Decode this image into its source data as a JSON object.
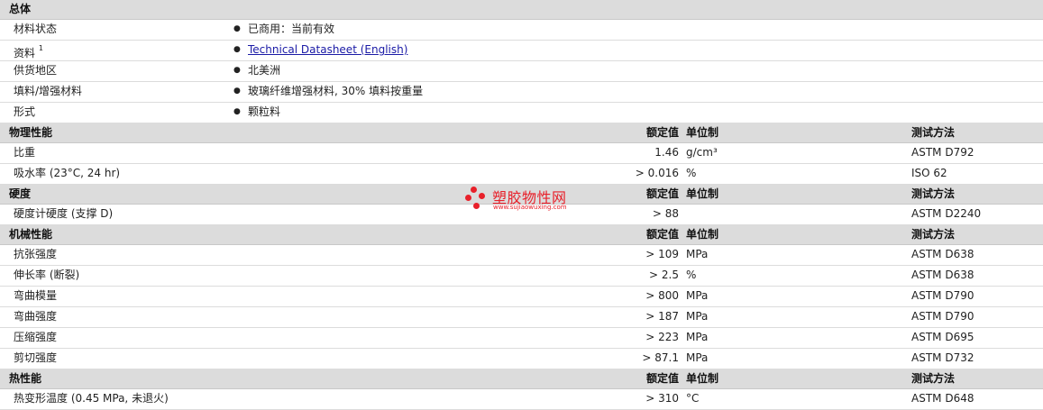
{
  "sections": {
    "general": {
      "title": "总体",
      "rows": [
        {
          "label": "材料状态",
          "sup": "",
          "value": "已商用：当前有效",
          "link": false
        },
        {
          "label": "资料",
          "sup": "1",
          "value": "Technical Datasheet (English)",
          "link": true
        },
        {
          "label": "供货地区",
          "sup": "",
          "value": "北美洲",
          "link": false
        },
        {
          "label": "填料/增强材料",
          "sup": "",
          "value": "玻璃纤维增强材料, 30% 填料按重量",
          "link": false
        },
        {
          "label": "形式",
          "sup": "",
          "value": "颗粒料",
          "link": false
        }
      ]
    },
    "physical": {
      "title": "物理性能",
      "col_value": "额定值",
      "col_unit": "单位制",
      "col_test": "测试方法",
      "rows": [
        {
          "label": "比重",
          "value": "1.46",
          "unit": "g/cm³",
          "test": "ASTM D792"
        },
        {
          "label": "吸水率 (23°C, 24 hr)",
          "value": "> 0.016",
          "unit": "%",
          "test": "ISO 62"
        }
      ]
    },
    "hardness": {
      "title": "硬度",
      "col_value": "额定值",
      "col_unit": "单位制",
      "col_test": "测试方法",
      "rows": [
        {
          "label": "硬度计硬度 (支撑 D)",
          "value": "> 88",
          "unit": "",
          "test": "ASTM D2240"
        }
      ]
    },
    "mechanical": {
      "title": "机械性能",
      "col_value": "额定值",
      "col_unit": "单位制",
      "col_test": "测试方法",
      "rows": [
        {
          "label": "抗张强度",
          "value": "> 109",
          "unit": "MPa",
          "test": "ASTM D638"
        },
        {
          "label": "伸长率 (断裂)",
          "value": "> 2.5",
          "unit": "%",
          "test": "ASTM D638"
        },
        {
          "label": "弯曲模量",
          "value": "> 800",
          "unit": "MPa",
          "test": "ASTM D790"
        },
        {
          "label": "弯曲强度",
          "value": "> 187",
          "unit": "MPa",
          "test": "ASTM D790"
        },
        {
          "label": "压缩强度",
          "value": "> 223",
          "unit": "MPa",
          "test": "ASTM D695"
        },
        {
          "label": "剪切强度",
          "value": "> 87.1",
          "unit": "MPa",
          "test": "ASTM D732"
        }
      ]
    },
    "thermal": {
      "title": "热性能",
      "col_value": "额定值",
      "col_unit": "单位制",
      "col_test": "测试方法",
      "rows": [
        {
          "label": "热变形温度 (0.45 MPa, 未退火)",
          "value": "> 310",
          "unit": "°C",
          "test": "ASTM D648"
        }
      ]
    }
  },
  "watermark": {
    "title": "塑胶物性网",
    "url": "www.sujiaowuxing.com",
    "color": "#e8202a"
  }
}
